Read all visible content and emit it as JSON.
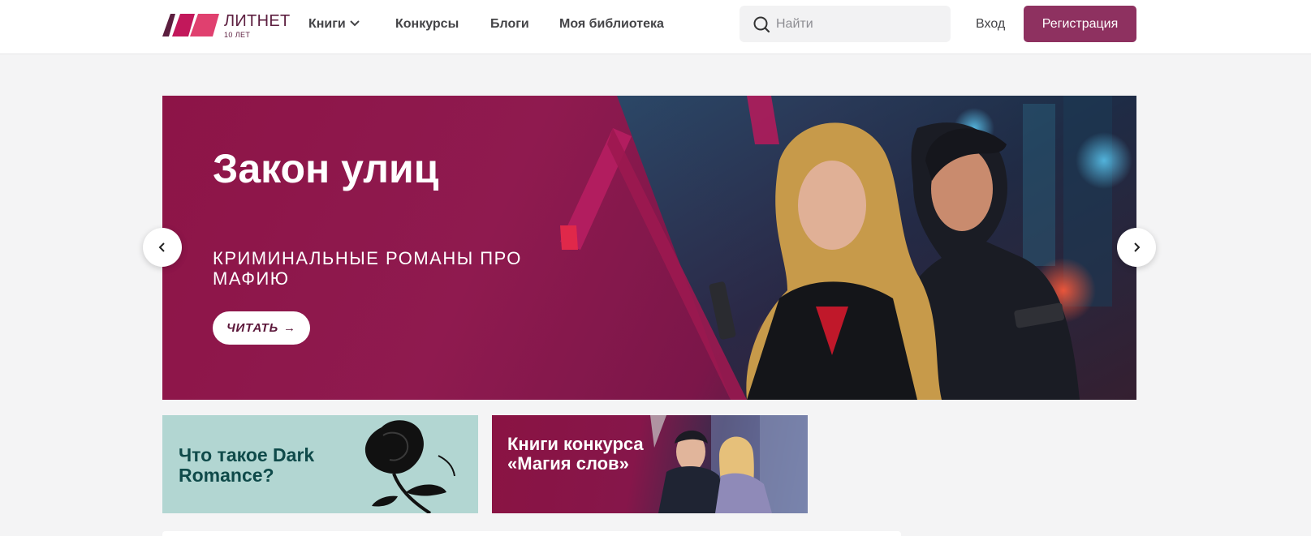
{
  "header": {
    "logo": {
      "name": "ЛИТНЕТ",
      "sub": "10 ЛЕТ"
    },
    "nav": {
      "books": "Книги",
      "contests": "Конкурсы",
      "blogs": "Блоги",
      "library": "Моя библиотека"
    },
    "search": {
      "placeholder": "Найти",
      "icon": "search-icon"
    },
    "login": "Вход",
    "register": "Регистрация",
    "brand_color": "#8e3160"
  },
  "hero": {
    "title": "Закон улиц",
    "subtitle": "КРИМИНАЛЬНЫЕ РОМАНЫ ПРО МАФИЮ",
    "cta": "ЧИТАТЬ",
    "cta_icon": "arrow-right-icon",
    "prev_icon": "chevron-left-icon",
    "next_icon": "chevron-right-icon"
  },
  "promos": [
    {
      "text": "Что такое Dark Romance?",
      "image": "black-rose"
    },
    {
      "text": "Книги конкурса «Магия слов»",
      "image": "couple-illustration"
    }
  ]
}
